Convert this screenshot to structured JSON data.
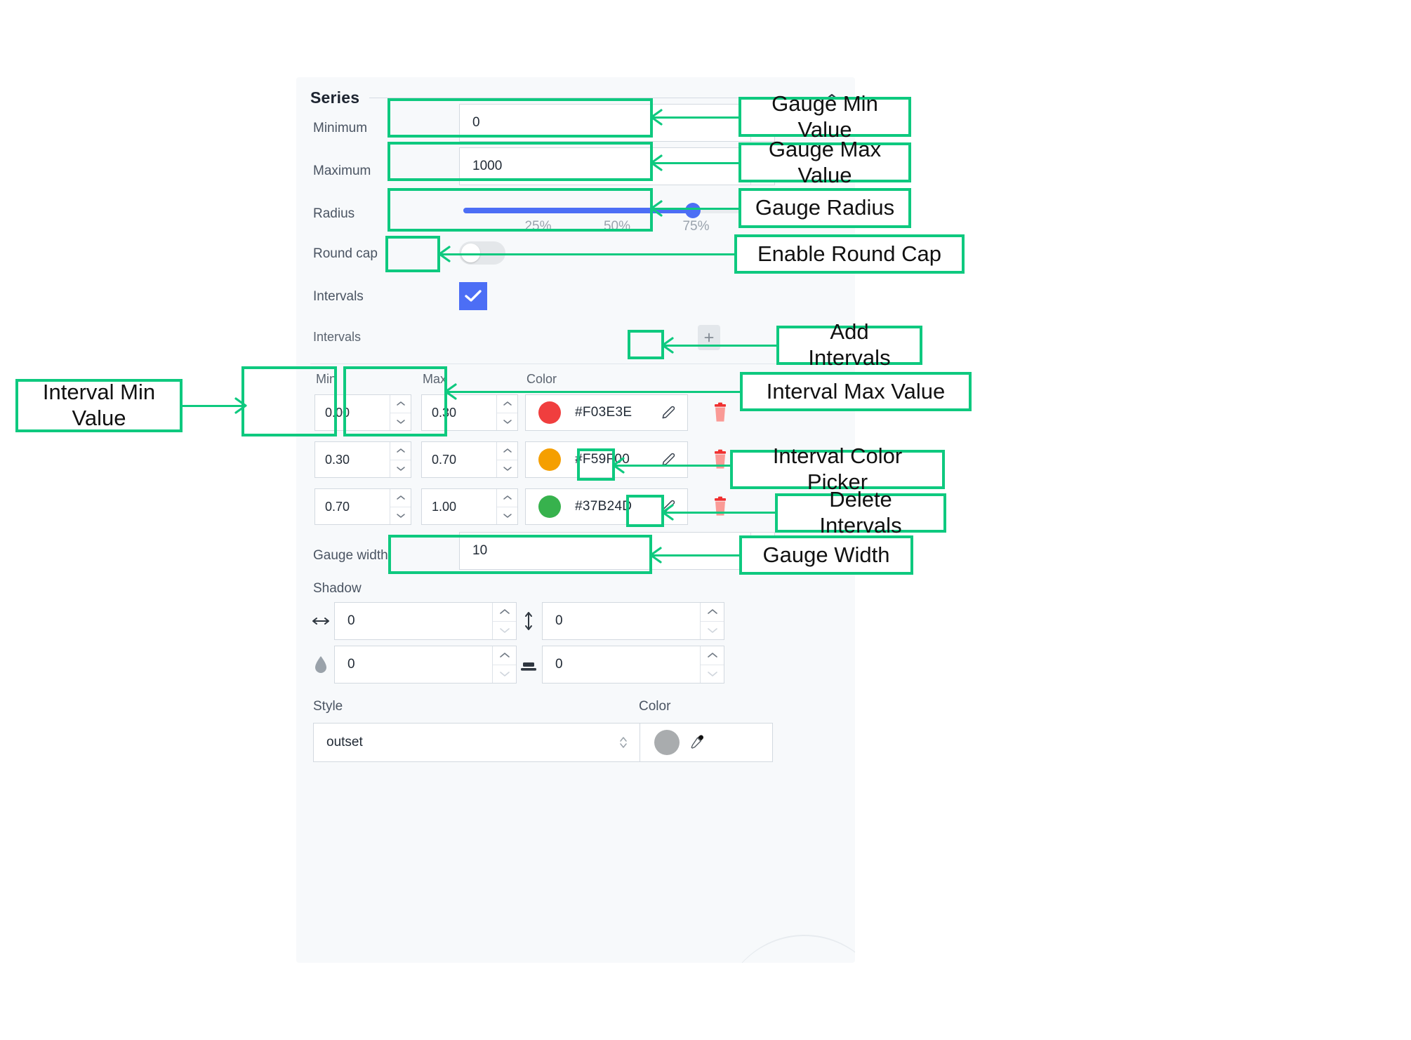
{
  "panel": {
    "section_title": "Series",
    "collapse_icon": "chevron-up-icon",
    "fields": {
      "minimum": {
        "label": "Minimum",
        "value": "0"
      },
      "maximum": {
        "label": "Maximum",
        "value": "1000"
      },
      "radius": {
        "label": "Radius",
        "value_percent": 75,
        "ticks": [
          "25%",
          "50%",
          "75%"
        ]
      },
      "round_cap": {
        "label": "Round cap",
        "enabled": false
      },
      "intervals_toggle": {
        "label": "Intervals",
        "checked": true
      },
      "intervals_list": {
        "label": "Intervals",
        "add_button_icon": "plus-icon"
      },
      "gauge_width": {
        "label": "Gauge width",
        "value": "10"
      }
    },
    "intervals_table": {
      "headers": {
        "min": "Min",
        "max": "Max",
        "color": "Color"
      },
      "rows": [
        {
          "min": "0.00",
          "max": "0.30",
          "hex": "#F03E3E",
          "swatch": "#F03E3E"
        },
        {
          "min": "0.30",
          "max": "0.70",
          "hex": "#F59F00",
          "swatch": "#F59F00"
        },
        {
          "min": "0.70",
          "max": "1.00",
          "hex": "#37B24D",
          "swatch": "#37B24D"
        }
      ],
      "row_edit_icon": "pencil-icon",
      "row_delete_icon": "trash-icon"
    },
    "shadow": {
      "label": "Shadow",
      "offset_x": {
        "icon": "horizontal-arrows-icon",
        "value": "0"
      },
      "offset_y": {
        "icon": "vertical-arrows-icon",
        "value": "0"
      },
      "blur": {
        "icon": "blur-drop-icon",
        "value": "0"
      },
      "spread": {
        "icon": "spread-icon",
        "value": "0"
      }
    },
    "border": {
      "style_label": "Style",
      "style_value": "outset",
      "color_label": "Color",
      "color_swatch": "#a9acae",
      "eyedropper_icon": "eyedropper-icon",
      "select_icon": "chevron-updown-icon"
    }
  },
  "annotations": {
    "accent_color": "#0EC97F",
    "items": [
      {
        "id": "gauge-min-value",
        "text": "Gauge Min Value"
      },
      {
        "id": "gauge-max-value",
        "text": "Gauge Max Value"
      },
      {
        "id": "gauge-radius",
        "text": "Gauge Radius"
      },
      {
        "id": "enable-round-cap",
        "text": "Enable Round Cap"
      },
      {
        "id": "add-intervals",
        "text": "Add Intervals"
      },
      {
        "id": "interval-max-value",
        "text": "Interval Max Value"
      },
      {
        "id": "interval-color-picker",
        "text": "Interval Color Picker"
      },
      {
        "id": "delete-intervals",
        "text": "Delete Intervals"
      },
      {
        "id": "gauge-width",
        "text": "Gauge Width"
      },
      {
        "id": "interval-min-value",
        "text": "Interval Min\nValue"
      }
    ]
  }
}
